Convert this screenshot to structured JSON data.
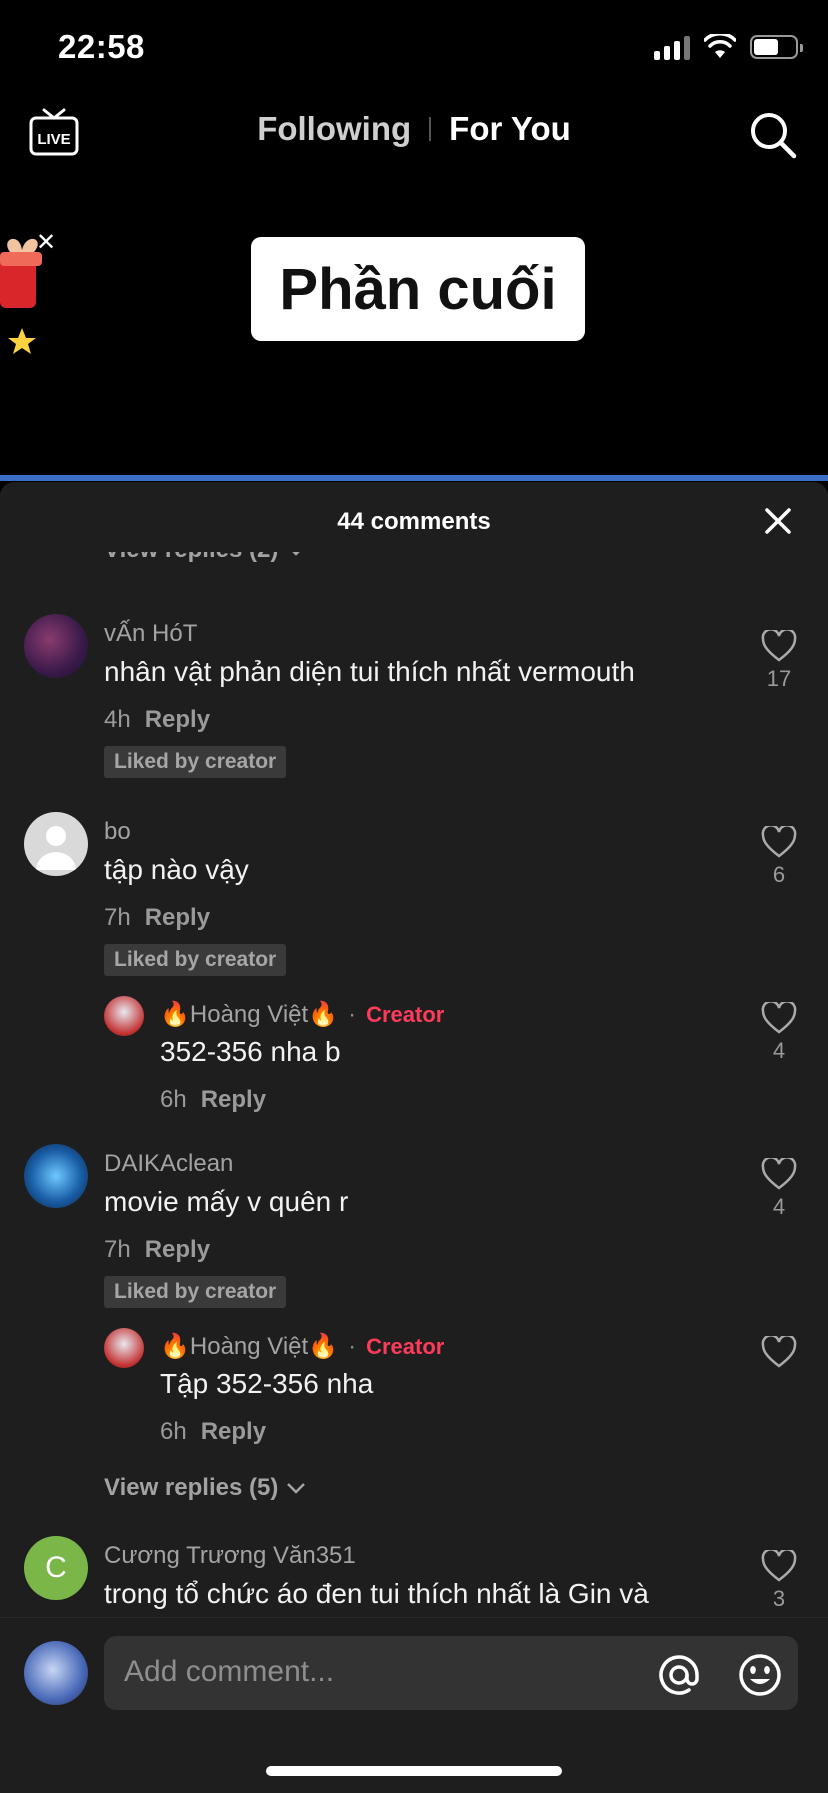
{
  "status": {
    "time": "22:58"
  },
  "nav": {
    "following": "Following",
    "for_you": "For You"
  },
  "video": {
    "caption": "Phần cuối"
  },
  "comments_panel": {
    "title": "44 comments",
    "top_view_replies": "View replies (2)",
    "comments": [
      {
        "user": "vẤn HóT",
        "text": "nhân vật phản diện tui thích nhất vermouth",
        "time": "4h",
        "reply": "Reply",
        "badge": "Liked by creator",
        "likes": "17"
      },
      {
        "user": "bo",
        "text": "tập nào vậy",
        "time": "7h",
        "reply": "Reply",
        "badge": "Liked by creator",
        "likes": "6"
      },
      {
        "user": "🔥Hoàng Việt🔥",
        "creator": "Creator",
        "text": "352-356 nha b",
        "time": "6h",
        "reply": "Reply",
        "likes": "4"
      },
      {
        "user": "DAIKAclean",
        "text": "movie mấy v quên r",
        "time": "7h",
        "reply": "Reply",
        "badge": "Liked by creator",
        "likes": "4"
      },
      {
        "user": "🔥Hoàng Việt🔥",
        "creator": "Creator",
        "text": "Tập 352-356 nha",
        "time": "6h",
        "reply": "Reply"
      },
      {
        "user": "Cương Trương Văn351",
        "avatar_letter": "C",
        "text": "trong tổ chức áo đen tui thích nhất là Gin và",
        "likes": "3"
      }
    ],
    "view_replies_5": "View replies (5)"
  },
  "composer": {
    "placeholder": "Add comment..."
  },
  "colors": {
    "accent_red": "#ff3b5c",
    "panel_bg": "#1e1e1e",
    "avatar_green": "#7ab648"
  }
}
